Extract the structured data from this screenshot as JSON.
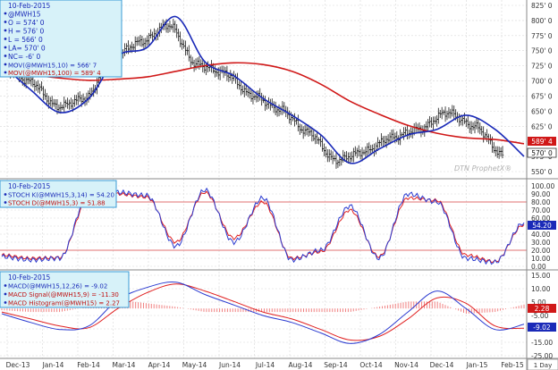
{
  "colors": {
    "background": "#ffffff",
    "grid_line": "#d8d8d8",
    "ohlc_bar": "#1a1a1a",
    "ma_fast": "#1a2ab8",
    "ma_slow": "#d01818",
    "stoch_k": "#2a3ad0",
    "stoch_d": "#e02020",
    "stoch_band": "#e07070",
    "macd": "#2a3ad0",
    "macd_signal": "#e02020",
    "macd_hist": "#f08080",
    "legend_bg": "#d7f2f9",
    "legend_border": "#3a9bd5",
    "legend_text": "#1a2ab8",
    "legend_text_red": "#c01010",
    "axis_text": "#333333",
    "watermark": "#b0b0b0"
  },
  "watermark": "DTN ProphetX®",
  "date_axis": {
    "labels": [
      "Dec-13",
      "Jan-14",
      "Feb-14",
      "Mar-14",
      "Apr-14",
      "May-14",
      "Jun-14",
      "Jul-14",
      "Aug-14",
      "Sep-14",
      "Oct-14",
      "Nov-14",
      "Dec-14",
      "Jan-15",
      "Feb-15"
    ],
    "interval": "1 Day"
  },
  "price_panel": {
    "legend": {
      "date": "10-Feb-2015",
      "symbol": "@MWH15",
      "open": "O = 574' 0",
      "high": "H = 576' 0",
      "low": "L = 566' 0",
      "last": "LA= 570' 0",
      "net_change": "NC= -6' 0",
      "ma_fast": "MOV(@MWH15,10) = 566' 7",
      "ma_slow": "MOV(@MWH15,100) = 589' 4"
    },
    "axis_labels": [
      "825' 0",
      "800' 0",
      "775' 0",
      "750' 0",
      "725' 0",
      "700' 0",
      "675' 0",
      "650' 0",
      "625' 0",
      "600' 0",
      "575' 0",
      "550' 0"
    ],
    "badges": {
      "ma_slow": "589' 4",
      "last": "570' 0"
    }
  },
  "stoch_panel": {
    "legend": {
      "date": "10-Feb-2015",
      "k": "STOCH K(@MWH15,3,14) = 54.20",
      "d": "STOCH D(@MWH15,3) = 51.88"
    },
    "axis_labels": [
      "100.00",
      "90.00",
      "80.00",
      "70.00",
      "60.00",
      "50.00",
      "40.00",
      "30.00",
      "20.00",
      "10.00",
      "0.00"
    ],
    "badge": "54.20"
  },
  "macd_panel": {
    "legend": {
      "date": "10-Feb-2015",
      "macd": "MACD(@MWH15,12,26) = -9.02",
      "signal": "MACD Signal(@MWH15,9) = -11.30",
      "hist": "MACD Histogram(@MWH15) = 2.27"
    },
    "axis_labels": [
      "15.00",
      "10.00",
      "5.00",
      "-5.00",
      "-10.00",
      "-15.00",
      "-25.00"
    ],
    "badges": {
      "hist": "2.28",
      "macd": "-9.02"
    }
  },
  "chart_data": {
    "type": "line",
    "title": "@MWH15",
    "x": [
      "Dec-13",
      "Jan-14",
      "Feb-14",
      "Mar-14",
      "Apr-14",
      "May-14",
      "Jun-14",
      "Jul-14",
      "Aug-14",
      "Sep-14",
      "Oct-14",
      "Nov-14",
      "Dec-14",
      "Jan-15",
      "Feb-15"
    ],
    "panels": [
      {
        "name": "price",
        "ylim": [
          540,
          835
        ],
        "series": [
          {
            "name": "@MWH15",
            "style": "ohlc",
            "values": [
              728,
              700,
              655,
              670,
              745,
              770,
              800,
              730,
              715,
              675,
              650,
              610,
              560,
              575,
              600,
              615,
              645,
              620,
              570
            ]
          },
          {
            "name": "MOV(@MWH15,10)",
            "values": [
              730,
              685,
              645,
              670,
              745,
              760,
              815,
              735,
              710,
              670,
              640,
              605,
              555,
              580,
              605,
              615,
              640,
              615,
              566.9
            ]
          },
          {
            "name": "MOV(@MWH15,100)",
            "values": [
              718,
              712,
              706,
              702,
              704,
              708,
              718,
              728,
              733,
              730,
              718,
              695,
              665,
              642,
              622,
              608,
              600,
              597,
              589.5
            ]
          }
        ]
      },
      {
        "name": "stochastic",
        "ylim": [
          0,
          100
        ],
        "reference_lines": [
          20,
          80
        ],
        "series": [
          {
            "name": "STOCH K(@MWH15,3,14)",
            "values": [
              12,
              8,
              10,
              90,
              92,
              88,
              25,
              95,
              30,
              85,
              8,
              20,
              75,
              10,
              90,
              80,
              10,
              5,
              54.2
            ]
          },
          {
            "name": "STOCH D(@MWH15,3)",
            "values": [
              14,
              10,
              11,
              85,
              90,
              86,
              30,
              92,
              35,
              80,
              10,
              18,
              70,
              12,
              85,
              82,
              14,
              6,
              51.88
            ]
          }
        ]
      },
      {
        "name": "macd",
        "ylim": [
          -27,
          19
        ],
        "series": [
          {
            "name": "MACD(@MWH15,12,26)",
            "values": [
              -3,
              -8,
              -12,
              -10,
              5,
              12,
              15,
              8,
              2,
              -4,
              -8,
              -14,
              -20,
              -15,
              -2,
              10,
              0,
              -12,
              -9.02
            ]
          },
          {
            "name": "MACD Signal(@MWH15,9)",
            "values": [
              -2,
              -6,
              -10,
              -11,
              0,
              9,
              14,
              10,
              4,
              -2,
              -6,
              -12,
              -18,
              -16,
              -6,
              6,
              3,
              -10,
              -11.3
            ]
          },
          {
            "name": "MACD Histogram(@MWH15)",
            "style": "histogram",
            "values": [
              -1,
              -2,
              -2,
              1,
              5,
              3,
              1,
              -2,
              -2,
              -2,
              -2,
              -2,
              -2,
              1,
              4,
              4,
              -3,
              -2,
              2.27
            ]
          }
        ]
      }
    ]
  }
}
